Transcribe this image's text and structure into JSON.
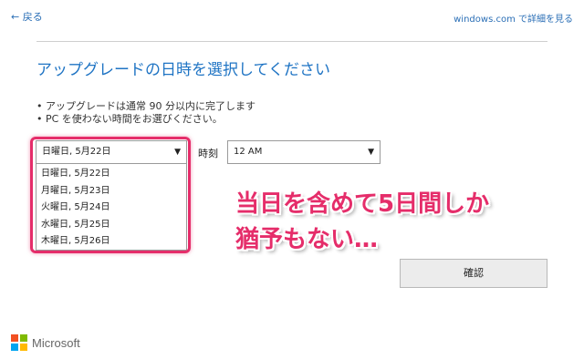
{
  "nav": {
    "back_label": "← 戻る",
    "learn_more": "windows.com で詳細を見る"
  },
  "page": {
    "title": "アップグレードの日時を選択してください",
    "bullets": [
      "アップグレードは通常 90 分以内に完了します",
      "PC を使わない時間をお選びください。"
    ]
  },
  "date_select": {
    "selected": "日曜日, 5月22日",
    "options": [
      "日曜日, 5月22日",
      "月曜日, 5月23日",
      "火曜日, 5月24日",
      "水曜日, 5月25日",
      "木曜日, 5月26日"
    ]
  },
  "time": {
    "label": "時刻",
    "selected": "12 AM"
  },
  "annotation": {
    "line1": "当日を含めて5日間しか",
    "line2": "猶予もない…",
    "color": "#e52d6a"
  },
  "confirm_label": "確認",
  "brand": {
    "name": "Microsoft",
    "logo_colors": [
      "#f25022",
      "#7fba00",
      "#00a4ef",
      "#ffb900"
    ]
  },
  "colors": {
    "link": "#2b6fb6",
    "title": "#1f74c4"
  }
}
